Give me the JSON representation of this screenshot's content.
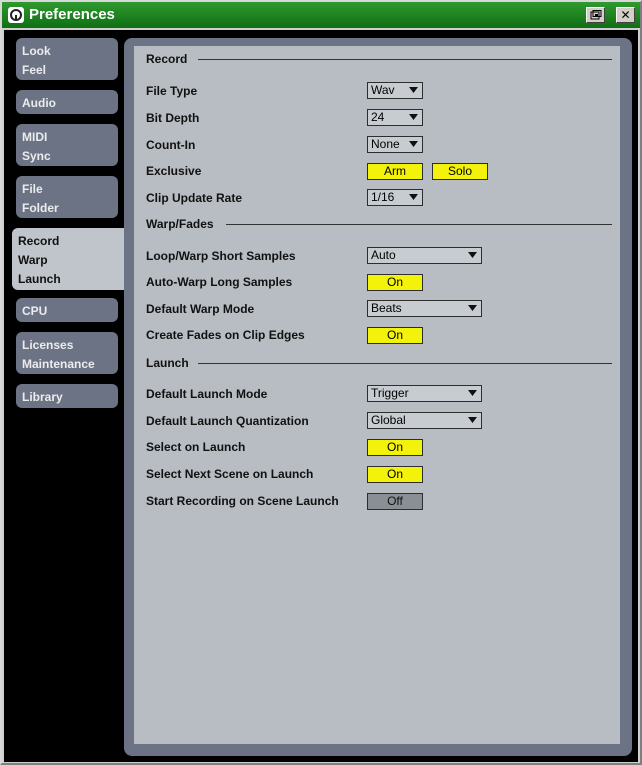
{
  "window": {
    "title": "Preferences",
    "restore_icon": "restore-icon",
    "close_symbol": "✕"
  },
  "sidebar": {
    "tabs": [
      {
        "lines": [
          "Look",
          "Feel"
        ]
      },
      {
        "lines": [
          "Audio"
        ]
      },
      {
        "lines": [
          "MIDI",
          "Sync"
        ]
      },
      {
        "lines": [
          "File",
          "Folder"
        ]
      },
      {
        "lines": [
          "Record",
          "Warp",
          "Launch"
        ]
      },
      {
        "lines": [
          "CPU"
        ]
      },
      {
        "lines": [
          "Licenses",
          "Maintenance"
        ]
      },
      {
        "lines": [
          "Library"
        ]
      }
    ],
    "active_index": 4
  },
  "sections": {
    "record": "Record",
    "warp": "Warp/Fades",
    "launch": "Launch"
  },
  "record": {
    "file_type": {
      "label": "File Type",
      "value": "Wav"
    },
    "bit_depth": {
      "label": "Bit Depth",
      "value": "24"
    },
    "count_in": {
      "label": "Count-In",
      "value": "None"
    },
    "exclusive": {
      "label": "Exclusive",
      "arm": "Arm",
      "solo": "Solo"
    },
    "clip_update": {
      "label": "Clip Update Rate",
      "value": "1/16"
    }
  },
  "warp": {
    "loop_warp": {
      "label": "Loop/Warp Short Samples",
      "value": "Auto"
    },
    "auto_warp": {
      "label": "Auto-Warp Long Samples",
      "value": "On"
    },
    "default_warp": {
      "label": "Default Warp Mode",
      "value": "Beats"
    },
    "fades": {
      "label": "Create Fades on Clip Edges",
      "value": "On"
    }
  },
  "launch": {
    "mode": {
      "label": "Default Launch Mode",
      "value": "Trigger"
    },
    "quant": {
      "label": "Default Launch Quantization",
      "value": "Global"
    },
    "select_on": {
      "label": "Select on Launch",
      "value": "On"
    },
    "select_next": {
      "label": "Select Next Scene on Launch",
      "value": "On"
    },
    "start_rec": {
      "label": "Start Recording on Scene Launch",
      "value": "Off"
    }
  },
  "colors": {
    "titlebar": "#1a7f1e",
    "toggle_on": "#f2f20a",
    "panel": "#6b7385",
    "content": "#b8bdc3"
  }
}
